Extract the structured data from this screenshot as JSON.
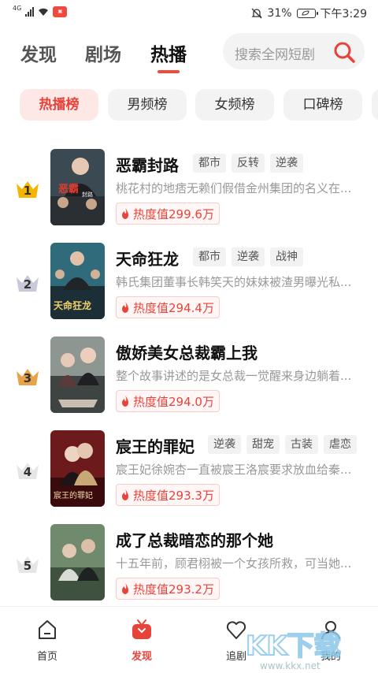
{
  "status": {
    "network": "4G",
    "battery": "31%",
    "time": "下午3:29"
  },
  "top_tabs": [
    {
      "label": "发现",
      "active": false
    },
    {
      "label": "剧场",
      "active": false
    },
    {
      "label": "热播",
      "active": true
    }
  ],
  "search": {
    "placeholder": "搜索全网短剧",
    "icon": "search-icon"
  },
  "chips": [
    {
      "label": "热播榜",
      "active": true
    },
    {
      "label": "男频榜",
      "active": false
    },
    {
      "label": "女频榜",
      "active": false
    },
    {
      "label": "口碑榜",
      "active": false
    }
  ],
  "items": [
    {
      "rank": "1",
      "title": "恶霸封路",
      "tags": [
        "都市",
        "反转",
        "逆袭"
      ],
      "desc": "桃花村的地痞无赖们假借金州集团的名义在...",
      "heat": "热度值299.6万",
      "cover_text": "恶霸 封路"
    },
    {
      "rank": "2",
      "title": "天命狂龙",
      "tags": [
        "都市",
        "逆袭",
        "战神"
      ],
      "desc": "韩氏集团董事长韩笑天的妹妹被渣男曝光私...",
      "heat": "热度值294.4万",
      "cover_text": "天命狂龙"
    },
    {
      "rank": "3",
      "title": "傲娇美女总裁霸上我",
      "tags": [],
      "desc": "整个故事讲述的是女总裁一觉醒来身边躺着...",
      "heat": "热度值294.0万",
      "cover_text": ""
    },
    {
      "rank": "4",
      "title": "宸王的罪妃",
      "tags": [
        "逆袭",
        "甜宠",
        "古装",
        "虐恋"
      ],
      "desc": "宸王妃徐婉杏一直被宸王洛宸要求放血给秦...",
      "heat": "热度值293.3万",
      "cover_text": "宸王的罪妃"
    },
    {
      "rank": "5",
      "title": "成了总裁暗恋的那个她",
      "tags": [],
      "desc": "十五年前，顾君栩被一个女孩所救，可当她...",
      "heat": "热度值293.2万",
      "cover_text": ""
    }
  ],
  "bottom_nav": [
    {
      "label": "首页",
      "icon": "home-icon",
      "active": false
    },
    {
      "label": "发现",
      "icon": "tv-icon",
      "active": true
    },
    {
      "label": "追剧",
      "icon": "heart-icon",
      "active": false
    },
    {
      "label": "我的",
      "icon": "user-icon",
      "active": false
    }
  ],
  "colors": {
    "accent": "#e8433a",
    "chip_active_bg": "#fde8e6",
    "gold": "#f5b400",
    "silver": "#b9b9c8",
    "bronze": "#e8a247"
  },
  "watermark": "KK下载 www.kkx.net"
}
